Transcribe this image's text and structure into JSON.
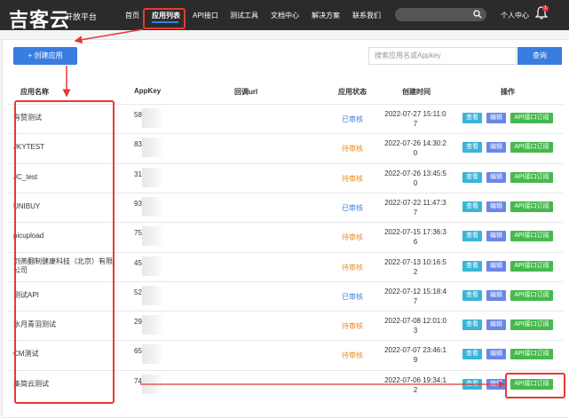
{
  "brand": {
    "logo": "吉客云",
    "subtitle": "开放平台"
  },
  "nav": {
    "items": [
      "首页",
      "应用列表",
      "API接口",
      "测试工具",
      "文档中心",
      "解决方案",
      "联系我们"
    ],
    "user": "个人中心",
    "bell_badge": "1"
  },
  "toolbar": {
    "create_label": "+ 创建应用",
    "search_placeholder": "搜索应用名或Appkey",
    "search_label": "查询"
  },
  "table": {
    "headers": [
      "应用名称",
      "AppKey",
      "回调url",
      "应用状态",
      "创建时间",
      "操作"
    ],
    "actions": {
      "view": "查看",
      "edit": "编辑",
      "api": "API接口订阅"
    },
    "rows": [
      {
        "name": "有赞测试",
        "appkey": "58",
        "status": "已审核",
        "status_type": "ok",
        "time": "2022-07-27 15:11:07"
      },
      {
        "name": "JKYTEST",
        "appkey": "83",
        "status": "待审核",
        "status_type": "wait",
        "time": "2022-07-26 14:30:20"
      },
      {
        "name": "JC_test",
        "appkey": "31",
        "status": "待审核",
        "status_type": "wait",
        "time": "2022-07-26 13:45:50"
      },
      {
        "name": "UNIBUY",
        "appkey": "93",
        "status": "已审核",
        "status_type": "ok",
        "time": "2022-07-22 11:47:37"
      },
      {
        "name": "picupload",
        "appkey": "756",
        "status": "待审核",
        "status_type": "wait",
        "time": "2022-07-15 17:36:36"
      },
      {
        "name": "刘燕翻制健康科技（北京）有限公司",
        "appkey": "457",
        "status": "待审核",
        "status_type": "wait",
        "time": "2022-07-13 10:16:52"
      },
      {
        "name": "测试API",
        "appkey": "520",
        "status": "已审核",
        "status_type": "ok",
        "time": "2022-07-12 15:18:47"
      },
      {
        "name": "水月青羽测试",
        "appkey": "291",
        "status": "待审核",
        "status_type": "wait",
        "time": "2022-07-08 12:01:03"
      },
      {
        "name": "CM测试",
        "appkey": "653",
        "status": "待审核",
        "status_type": "wait",
        "time": "2022-07-07 23:46:19"
      },
      {
        "name": "集简云测试",
        "appkey": "74",
        "status": "",
        "status_type": "ok",
        "time": "2022-07-06 19:34:12"
      }
    ]
  },
  "colors": {
    "primary": "#3a7de0",
    "annotation": "#e53935",
    "ok": "#3a7de0",
    "wait": "#e8891e"
  }
}
